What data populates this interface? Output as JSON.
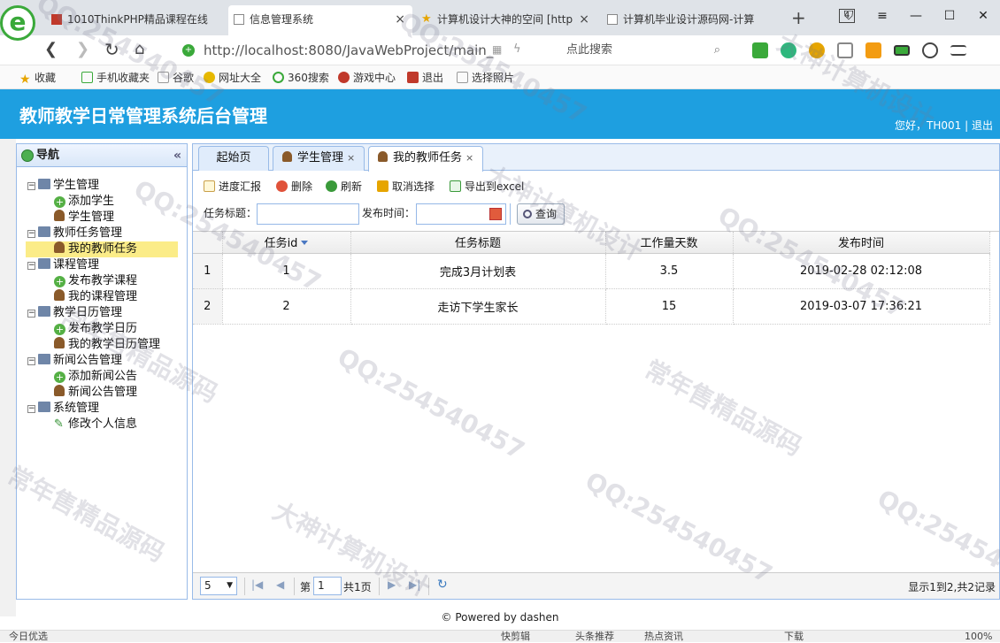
{
  "browser": {
    "tabs": [
      {
        "label": "1010ThinkPHP精品课程在线",
        "close": "×"
      },
      {
        "label": "信息管理系统",
        "close": "×"
      },
      {
        "label": "计算机设计大神的空间 [http",
        "close": "×"
      },
      {
        "label": "计算机毕业设计源码网-计算",
        "close": ""
      }
    ],
    "new_tab": "+",
    "tab_count": "4",
    "url": "http://localhost:8080/JavaWebProject/main_",
    "search_placeholder": "点此搜索",
    "bookmarks": [
      "收藏",
      "手机收藏夹",
      "谷歌",
      "网址大全",
      "360搜索",
      "游戏中心",
      "退出",
      "选择照片"
    ]
  },
  "app": {
    "title": "教师教学日常管理系统后台管理",
    "greeting": "您好，TH001",
    "sep": "|",
    "logout": "退出"
  },
  "nav": {
    "title": "导航",
    "collapse": "«",
    "groups": [
      {
        "label": "学生管理",
        "items": [
          "添加学生",
          "学生管理"
        ]
      },
      {
        "label": "教师任务管理",
        "items": [
          "我的教师任务"
        ]
      },
      {
        "label": "课程管理",
        "items": [
          "发布教学课程",
          "我的课程管理"
        ]
      },
      {
        "label": "教学日历管理",
        "items": [
          "发布教学日历",
          "我的教学日历管理"
        ]
      },
      {
        "label": "新闻公告管理",
        "items": [
          "添加新闻公告",
          "新闻公告管理"
        ]
      },
      {
        "label": "系统管理",
        "items": [
          "修改个人信息"
        ]
      }
    ],
    "expanded_glyph": "−"
  },
  "content_tabs": [
    {
      "label": "起始页"
    },
    {
      "label": "学生管理",
      "close": "×"
    },
    {
      "label": "我的教师任务",
      "close": "×"
    }
  ],
  "toolbar": {
    "progress": "进度汇报",
    "delete": "删除",
    "refresh": "刷新",
    "cancel_select": "取消选择",
    "export": "导出到excel"
  },
  "filter": {
    "title_label": "任务标题：",
    "date_label": "发布时间：",
    "query": "查询"
  },
  "grid": {
    "columns": [
      "任务id",
      "任务标题",
      "工作量天数",
      "发布时间"
    ],
    "rows": [
      {
        "rn": "1",
        "id": "1",
        "title": "完成3月计划表",
        "days": "3.5",
        "time": "2019-02-28 02:12:08"
      },
      {
        "rn": "2",
        "id": "2",
        "title": "走访下学生家长",
        "days": "15",
        "time": "2019-03-07 17:36:21"
      }
    ]
  },
  "pager": {
    "page_size": "5",
    "page_prefix": "第",
    "page": "1",
    "page_suffix": "共1页",
    "summary": "显示1到2,共2记录"
  },
  "footer": "© Powered by dashen",
  "statusbar": {
    "left": "今日优选",
    "items": [
      "快剪辑",
      "头条推荐",
      "热点资讯",
      "下载"
    ],
    "zoom": "100%"
  },
  "watermark": [
    "QQ:254540457",
    "大神计算机设计",
    "常年售精品源码"
  ]
}
